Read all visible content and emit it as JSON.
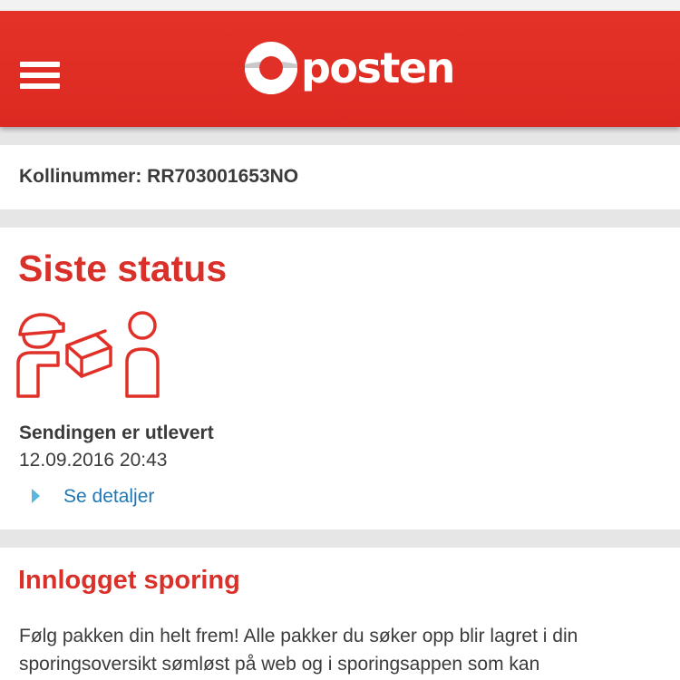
{
  "header": {
    "logo_text": "posten",
    "menu_icon": "hamburger-menu-icon",
    "color": "#e03028"
  },
  "shipment": {
    "kolli_label": "Kollinummer: RR703001653NO"
  },
  "status": {
    "title": "Siste status",
    "icon": "package-delivered-icon",
    "text": "Sendingen er utlevert",
    "datetime": "12.09.2016 20:43",
    "details_link": "Se detaljer"
  },
  "login": {
    "title": "Innlogget sporing",
    "body": "Følg pakken din helt frem! Alle pakker du søker opp blir lagret i din sporingsoversikt sømløst på web og i sporingsappen som kan"
  },
  "colors": {
    "accent": "#d9302a",
    "link": "#1d78b5",
    "link_arrow": "#58b7dd",
    "text": "#3b3b3b",
    "background": "#e6e6e6"
  }
}
